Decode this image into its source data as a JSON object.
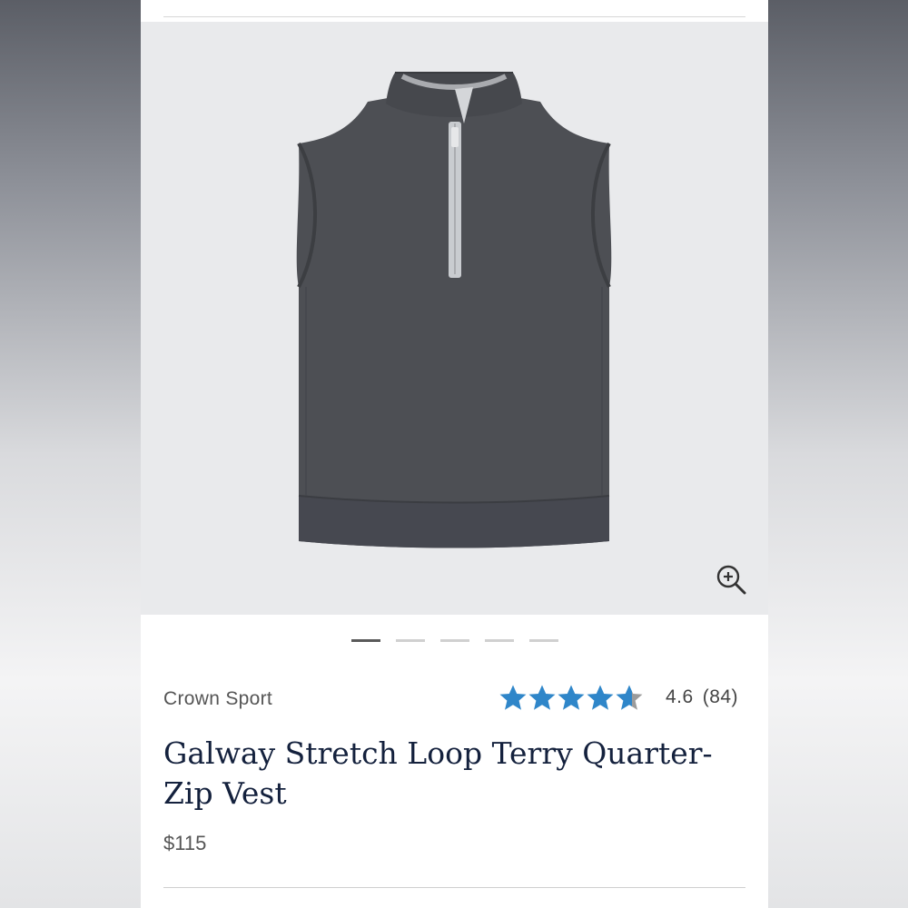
{
  "product": {
    "brand": "Crown Sport",
    "title": "Galway Stretch Loop Terry Quarter-Zip Vest",
    "price": "$115",
    "rating_value": "4.6",
    "review_count": "(84)",
    "rating_stars": 4.6,
    "rating_max": 5,
    "image_subject": "charcoal quarter-zip vest"
  },
  "gallery": {
    "image_count": 5,
    "active_index": 0,
    "zoom_icon": "zoom-in-icon"
  },
  "colors": {
    "star": "#2f86c9",
    "star_empty": "#9b9b9b",
    "title": "#14213d",
    "vest": "#4d4f54",
    "zip_trim": "#c9ccd0",
    "hero_bg": "#e9eaec"
  }
}
